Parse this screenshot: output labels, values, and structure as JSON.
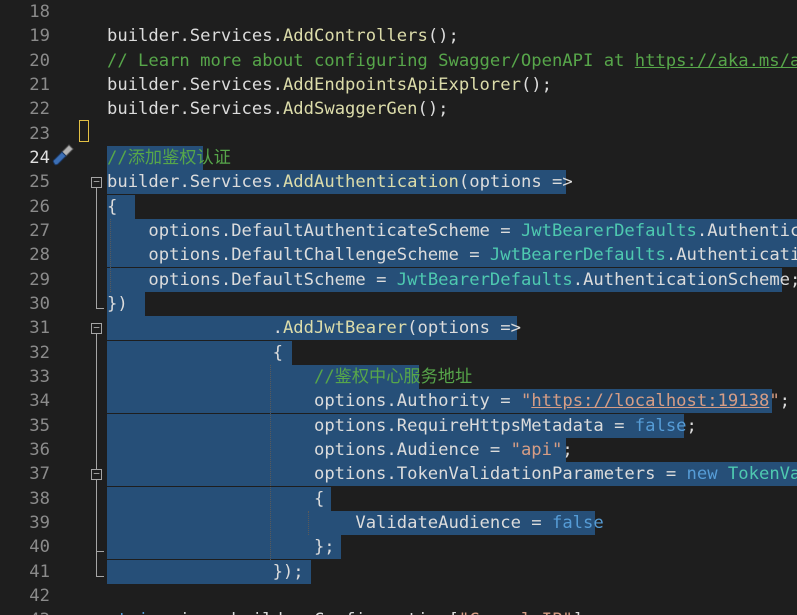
{
  "editor": {
    "lines": [
      {
        "n": "18",
        "tokens": []
      },
      {
        "n": "19",
        "tokens": [
          [
            "builder",
            "ident"
          ],
          [
            ".",
            "plain"
          ],
          [
            "Services",
            "ident"
          ],
          [
            ".",
            "plain"
          ],
          [
            "AddControllers",
            "method"
          ],
          [
            "();",
            "plain"
          ]
        ]
      },
      {
        "n": "20",
        "tokens": [
          [
            "// Learn more about configuring Swagger/OpenAPI at ",
            "comment"
          ],
          [
            "https://aka.ms/aspnetcore/swashbuckle",
            "link"
          ]
        ]
      },
      {
        "n": "21",
        "tokens": [
          [
            "builder",
            "ident"
          ],
          [
            ".",
            "plain"
          ],
          [
            "Services",
            "ident"
          ],
          [
            ".",
            "plain"
          ],
          [
            "AddEndpointsApiExplorer",
            "method"
          ],
          [
            "();",
            "plain"
          ]
        ]
      },
      {
        "n": "22",
        "tokens": [
          [
            "builder",
            "ident"
          ],
          [
            ".",
            "plain"
          ],
          [
            "Services",
            "ident"
          ],
          [
            ".",
            "plain"
          ],
          [
            "AddSwaggerGen",
            "method"
          ],
          [
            "();",
            "plain"
          ]
        ]
      },
      {
        "n": "23",
        "tokens": []
      },
      {
        "n": "24",
        "tokens": [
          [
            "//添加鉴权认证",
            "comment"
          ]
        ]
      },
      {
        "n": "25",
        "tokens": [
          [
            "builder",
            "ident"
          ],
          [
            ".",
            "plain"
          ],
          [
            "Services",
            "ident"
          ],
          [
            ".",
            "plain"
          ],
          [
            "AddAuthentication",
            "method"
          ],
          [
            "(",
            "plain"
          ],
          [
            "options",
            "ident"
          ],
          [
            " =>",
            "plain"
          ]
        ]
      },
      {
        "n": "26",
        "tokens": [
          [
            "{",
            "plain"
          ]
        ]
      },
      {
        "n": "27",
        "tokens": [
          [
            "    ",
            "plain"
          ],
          [
            "options",
            "ident"
          ],
          [
            ".",
            "plain"
          ],
          [
            "DefaultAuthenticateScheme",
            "ident"
          ],
          [
            " = ",
            "plain"
          ],
          [
            "JwtBearerDefaults",
            "type"
          ],
          [
            ".",
            "plain"
          ],
          [
            "AuthenticationScheme",
            "ident"
          ],
          [
            ";",
            "plain"
          ]
        ]
      },
      {
        "n": "28",
        "tokens": [
          [
            "    ",
            "plain"
          ],
          [
            "options",
            "ident"
          ],
          [
            ".",
            "plain"
          ],
          [
            "DefaultChallengeScheme",
            "ident"
          ],
          [
            " = ",
            "plain"
          ],
          [
            "JwtBearerDefaults",
            "type"
          ],
          [
            ".",
            "plain"
          ],
          [
            "AuthenticationScheme",
            "ident"
          ],
          [
            ";",
            "plain"
          ]
        ]
      },
      {
        "n": "29",
        "tokens": [
          [
            "    ",
            "plain"
          ],
          [
            "options",
            "ident"
          ],
          [
            ".",
            "plain"
          ],
          [
            "DefaultScheme",
            "ident"
          ],
          [
            " = ",
            "plain"
          ],
          [
            "JwtBearerDefaults",
            "type"
          ],
          [
            ".",
            "plain"
          ],
          [
            "AuthenticationScheme",
            "ident"
          ],
          [
            ";",
            "plain"
          ]
        ]
      },
      {
        "n": "30",
        "tokens": [
          [
            "})",
            "plain"
          ]
        ]
      },
      {
        "n": "31",
        "tokens": [
          [
            "                ",
            "plain"
          ],
          [
            ".",
            "plain"
          ],
          [
            "AddJwtBearer",
            "method"
          ],
          [
            "(",
            "plain"
          ],
          [
            "options",
            "ident"
          ],
          [
            " =>",
            "plain"
          ]
        ]
      },
      {
        "n": "32",
        "tokens": [
          [
            "                {",
            "plain"
          ]
        ]
      },
      {
        "n": "33",
        "tokens": [
          [
            "                    ",
            "plain"
          ],
          [
            "//鉴权中心服务地址",
            "comment"
          ]
        ]
      },
      {
        "n": "34",
        "tokens": [
          [
            "                    ",
            "plain"
          ],
          [
            "options",
            "ident"
          ],
          [
            ".",
            "plain"
          ],
          [
            "Authority",
            "ident"
          ],
          [
            " = ",
            "plain"
          ],
          [
            "\"",
            "string"
          ],
          [
            "https://localhost:19138",
            "strlink"
          ],
          [
            "\"",
            "string"
          ],
          [
            ";",
            "plain"
          ]
        ]
      },
      {
        "n": "35",
        "tokens": [
          [
            "                    ",
            "plain"
          ],
          [
            "options",
            "ident"
          ],
          [
            ".",
            "plain"
          ],
          [
            "RequireHttpsMetadata",
            "ident"
          ],
          [
            " = ",
            "plain"
          ],
          [
            "false",
            "keyword"
          ],
          [
            ";",
            "plain"
          ]
        ]
      },
      {
        "n": "36",
        "tokens": [
          [
            "                    ",
            "plain"
          ],
          [
            "options",
            "ident"
          ],
          [
            ".",
            "plain"
          ],
          [
            "Audience",
            "ident"
          ],
          [
            " = ",
            "plain"
          ],
          [
            "\"api\"",
            "string"
          ],
          [
            ";",
            "plain"
          ]
        ]
      },
      {
        "n": "37",
        "tokens": [
          [
            "                    ",
            "plain"
          ],
          [
            "options",
            "ident"
          ],
          [
            ".",
            "plain"
          ],
          [
            "TokenValidationParameters",
            "ident"
          ],
          [
            " = ",
            "plain"
          ],
          [
            "new",
            "keyword"
          ],
          [
            " ",
            "plain"
          ],
          [
            "TokenValidationParameters",
            "type"
          ]
        ]
      },
      {
        "n": "38",
        "tokens": [
          [
            "                    {",
            "plain"
          ]
        ]
      },
      {
        "n": "39",
        "tokens": [
          [
            "                        ",
            "plain"
          ],
          [
            "ValidateAudience",
            "ident"
          ],
          [
            " = ",
            "plain"
          ],
          [
            "false",
            "keyword"
          ]
        ]
      },
      {
        "n": "40",
        "tokens": [
          [
            "                    };",
            "plain"
          ]
        ]
      },
      {
        "n": "41",
        "tokens": [
          [
            "                });",
            "plain"
          ]
        ]
      },
      {
        "n": "42",
        "tokens": []
      },
      {
        "n": "43",
        "tokens": [
          [
            "string",
            "keyword"
          ],
          [
            " ",
            "plain"
          ],
          [
            "ip",
            "ident"
          ],
          [
            " = ",
            "plain"
          ],
          [
            "builder",
            "ident"
          ],
          [
            ".",
            "plain"
          ],
          [
            "Configuration",
            "ident"
          ],
          [
            "[",
            "plain"
          ],
          [
            "\"Consul:IP\"",
            "string"
          ],
          [
            "];",
            "plain"
          ]
        ]
      }
    ]
  }
}
